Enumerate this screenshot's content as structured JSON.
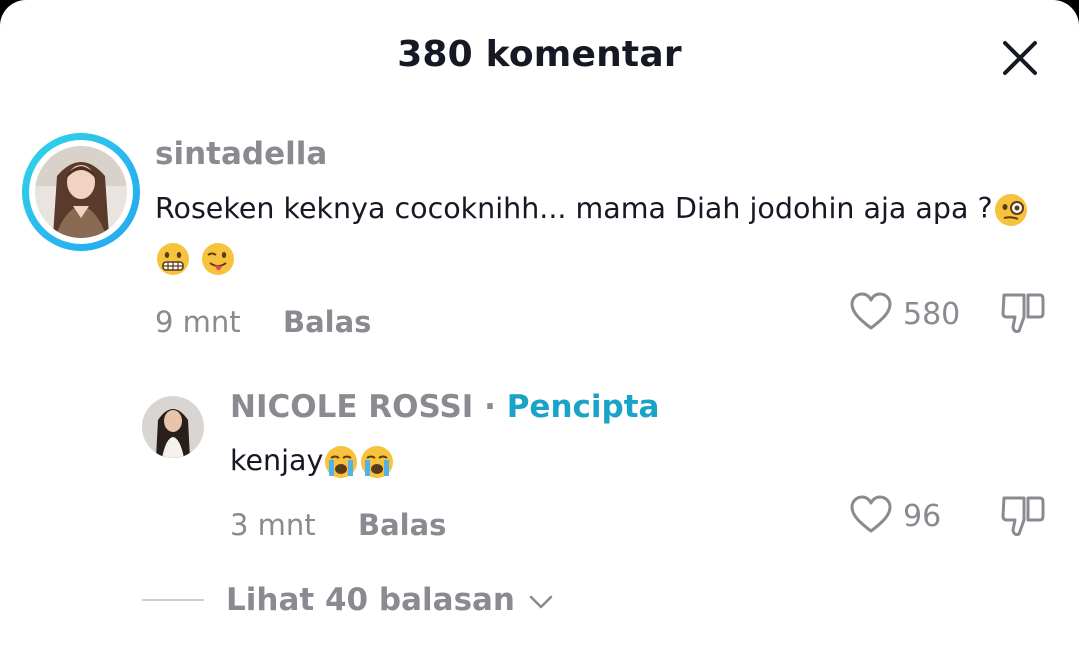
{
  "header": {
    "title": "380 komentar",
    "close_icon": "close-icon"
  },
  "comment": {
    "username": "sintadella",
    "text_line1": "Roseken keknya cocoknihh... mama Diah jodohin aja apa ?",
    "emoji_line1": [
      "face-with-monocle"
    ],
    "emoji_line2": [
      "grimacing-face",
      "winking-face-with-tongue"
    ],
    "time": "9 mnt",
    "reply_label": "Balas",
    "like_count": "580",
    "has_story_ring": true,
    "ring_color": "#2ab8ef"
  },
  "reply": {
    "username": "NICOLE ROSSI",
    "separator": "·",
    "badge": "Pencipta",
    "text": "kenjay",
    "emoji": [
      "loudly-crying-face",
      "loudly-crying-face"
    ],
    "time": "3 mnt",
    "reply_label": "Balas",
    "like_count": "96"
  },
  "view_replies": {
    "label": "Lihat 40 balasan",
    "icon": "chevron-down-icon"
  },
  "colors": {
    "text_primary": "#161823",
    "text_secondary": "#8a8b91",
    "creator_badge": "#1aa3c8"
  }
}
